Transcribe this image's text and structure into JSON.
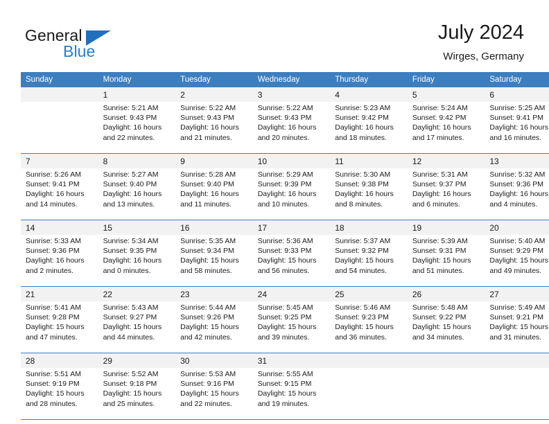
{
  "brand": {
    "name_top": "General",
    "name_bottom": "Blue",
    "accent_color": "#1f7fd4",
    "triangle_color": "#1f6fbe"
  },
  "header": {
    "title": "July 2024",
    "subtitle": "Wirges, Germany",
    "header_bg": "#3d7ebf",
    "daynum_bg": "#f2f2f2"
  },
  "weekdays": [
    "Sunday",
    "Monday",
    "Tuesday",
    "Wednesday",
    "Thursday",
    "Friday",
    "Saturday"
  ],
  "weeks": [
    {
      "days": [
        {
          "day": "",
          "sunrise": "",
          "sunset": "",
          "daylight_1": "",
          "daylight_2": ""
        },
        {
          "day": "1",
          "sunrise": "Sunrise: 5:21 AM",
          "sunset": "Sunset: 9:43 PM",
          "daylight_1": "Daylight: 16 hours",
          "daylight_2": "and 22 minutes."
        },
        {
          "day": "2",
          "sunrise": "Sunrise: 5:22 AM",
          "sunset": "Sunset: 9:43 PM",
          "daylight_1": "Daylight: 16 hours",
          "daylight_2": "and 21 minutes."
        },
        {
          "day": "3",
          "sunrise": "Sunrise: 5:22 AM",
          "sunset": "Sunset: 9:43 PM",
          "daylight_1": "Daylight: 16 hours",
          "daylight_2": "and 20 minutes."
        },
        {
          "day": "4",
          "sunrise": "Sunrise: 5:23 AM",
          "sunset": "Sunset: 9:42 PM",
          "daylight_1": "Daylight: 16 hours",
          "daylight_2": "and 18 minutes."
        },
        {
          "day": "5",
          "sunrise": "Sunrise: 5:24 AM",
          "sunset": "Sunset: 9:42 PM",
          "daylight_1": "Daylight: 16 hours",
          "daylight_2": "and 17 minutes."
        },
        {
          "day": "6",
          "sunrise": "Sunrise: 5:25 AM",
          "sunset": "Sunset: 9:41 PM",
          "daylight_1": "Daylight: 16 hours",
          "daylight_2": "and 16 minutes."
        }
      ]
    },
    {
      "days": [
        {
          "day": "7",
          "sunrise": "Sunrise: 5:26 AM",
          "sunset": "Sunset: 9:41 PM",
          "daylight_1": "Daylight: 16 hours",
          "daylight_2": "and 14 minutes."
        },
        {
          "day": "8",
          "sunrise": "Sunrise: 5:27 AM",
          "sunset": "Sunset: 9:40 PM",
          "daylight_1": "Daylight: 16 hours",
          "daylight_2": "and 13 minutes."
        },
        {
          "day": "9",
          "sunrise": "Sunrise: 5:28 AM",
          "sunset": "Sunset: 9:40 PM",
          "daylight_1": "Daylight: 16 hours",
          "daylight_2": "and 11 minutes."
        },
        {
          "day": "10",
          "sunrise": "Sunrise: 5:29 AM",
          "sunset": "Sunset: 9:39 PM",
          "daylight_1": "Daylight: 16 hours",
          "daylight_2": "and 10 minutes."
        },
        {
          "day": "11",
          "sunrise": "Sunrise: 5:30 AM",
          "sunset": "Sunset: 9:38 PM",
          "daylight_1": "Daylight: 16 hours",
          "daylight_2": "and 8 minutes."
        },
        {
          "day": "12",
          "sunrise": "Sunrise: 5:31 AM",
          "sunset": "Sunset: 9:37 PM",
          "daylight_1": "Daylight: 16 hours",
          "daylight_2": "and 6 minutes."
        },
        {
          "day": "13",
          "sunrise": "Sunrise: 5:32 AM",
          "sunset": "Sunset: 9:36 PM",
          "daylight_1": "Daylight: 16 hours",
          "daylight_2": "and 4 minutes."
        }
      ]
    },
    {
      "days": [
        {
          "day": "14",
          "sunrise": "Sunrise: 5:33 AM",
          "sunset": "Sunset: 9:36 PM",
          "daylight_1": "Daylight: 16 hours",
          "daylight_2": "and 2 minutes."
        },
        {
          "day": "15",
          "sunrise": "Sunrise: 5:34 AM",
          "sunset": "Sunset: 9:35 PM",
          "daylight_1": "Daylight: 16 hours",
          "daylight_2": "and 0 minutes."
        },
        {
          "day": "16",
          "sunrise": "Sunrise: 5:35 AM",
          "sunset": "Sunset: 9:34 PM",
          "daylight_1": "Daylight: 15 hours",
          "daylight_2": "and 58 minutes."
        },
        {
          "day": "17",
          "sunrise": "Sunrise: 5:36 AM",
          "sunset": "Sunset: 9:33 PM",
          "daylight_1": "Daylight: 15 hours",
          "daylight_2": "and 56 minutes."
        },
        {
          "day": "18",
          "sunrise": "Sunrise: 5:37 AM",
          "sunset": "Sunset: 9:32 PM",
          "daylight_1": "Daylight: 15 hours",
          "daylight_2": "and 54 minutes."
        },
        {
          "day": "19",
          "sunrise": "Sunrise: 5:39 AM",
          "sunset": "Sunset: 9:31 PM",
          "daylight_1": "Daylight: 15 hours",
          "daylight_2": "and 51 minutes."
        },
        {
          "day": "20",
          "sunrise": "Sunrise: 5:40 AM",
          "sunset": "Sunset: 9:29 PM",
          "daylight_1": "Daylight: 15 hours",
          "daylight_2": "and 49 minutes."
        }
      ]
    },
    {
      "days": [
        {
          "day": "21",
          "sunrise": "Sunrise: 5:41 AM",
          "sunset": "Sunset: 9:28 PM",
          "daylight_1": "Daylight: 15 hours",
          "daylight_2": "and 47 minutes."
        },
        {
          "day": "22",
          "sunrise": "Sunrise: 5:43 AM",
          "sunset": "Sunset: 9:27 PM",
          "daylight_1": "Daylight: 15 hours",
          "daylight_2": "and 44 minutes."
        },
        {
          "day": "23",
          "sunrise": "Sunrise: 5:44 AM",
          "sunset": "Sunset: 9:26 PM",
          "daylight_1": "Daylight: 15 hours",
          "daylight_2": "and 42 minutes."
        },
        {
          "day": "24",
          "sunrise": "Sunrise: 5:45 AM",
          "sunset": "Sunset: 9:25 PM",
          "daylight_1": "Daylight: 15 hours",
          "daylight_2": "and 39 minutes."
        },
        {
          "day": "25",
          "sunrise": "Sunrise: 5:46 AM",
          "sunset": "Sunset: 9:23 PM",
          "daylight_1": "Daylight: 15 hours",
          "daylight_2": "and 36 minutes."
        },
        {
          "day": "26",
          "sunrise": "Sunrise: 5:48 AM",
          "sunset": "Sunset: 9:22 PM",
          "daylight_1": "Daylight: 15 hours",
          "daylight_2": "and 34 minutes."
        },
        {
          "day": "27",
          "sunrise": "Sunrise: 5:49 AM",
          "sunset": "Sunset: 9:21 PM",
          "daylight_1": "Daylight: 15 hours",
          "daylight_2": "and 31 minutes."
        }
      ]
    },
    {
      "days": [
        {
          "day": "28",
          "sunrise": "Sunrise: 5:51 AM",
          "sunset": "Sunset: 9:19 PM",
          "daylight_1": "Daylight: 15 hours",
          "daylight_2": "and 28 minutes."
        },
        {
          "day": "29",
          "sunrise": "Sunrise: 5:52 AM",
          "sunset": "Sunset: 9:18 PM",
          "daylight_1": "Daylight: 15 hours",
          "daylight_2": "and 25 minutes."
        },
        {
          "day": "30",
          "sunrise": "Sunrise: 5:53 AM",
          "sunset": "Sunset: 9:16 PM",
          "daylight_1": "Daylight: 15 hours",
          "daylight_2": "and 22 minutes."
        },
        {
          "day": "31",
          "sunrise": "Sunrise: 5:55 AM",
          "sunset": "Sunset: 9:15 PM",
          "daylight_1": "Daylight: 15 hours",
          "daylight_2": "and 19 minutes."
        },
        {
          "day": "",
          "sunrise": "",
          "sunset": "",
          "daylight_1": "",
          "daylight_2": ""
        },
        {
          "day": "",
          "sunrise": "",
          "sunset": "",
          "daylight_1": "",
          "daylight_2": ""
        },
        {
          "day": "",
          "sunrise": "",
          "sunset": "",
          "daylight_1": "",
          "daylight_2": ""
        }
      ]
    }
  ]
}
